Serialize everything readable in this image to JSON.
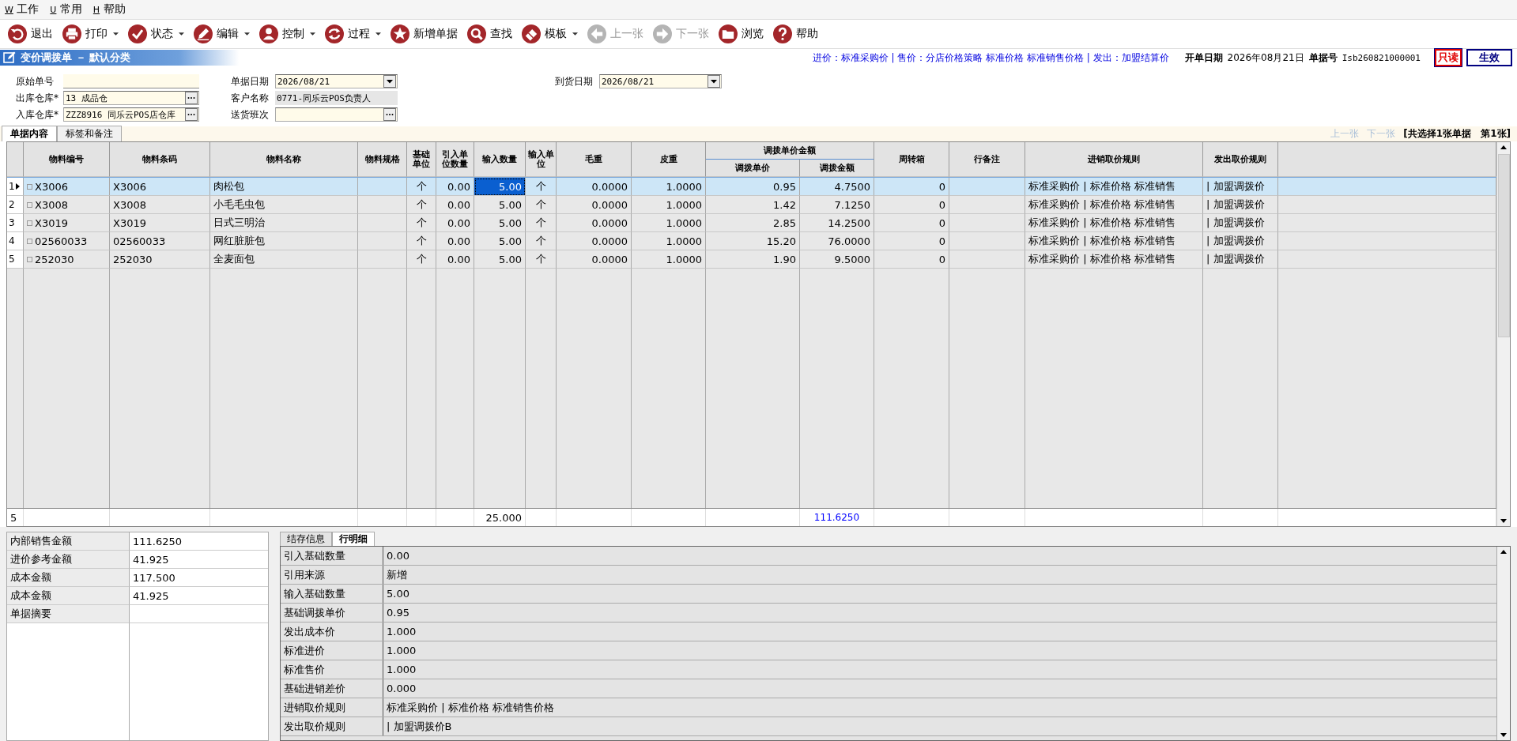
{
  "menu": [
    {
      "key": "W",
      "label": "工作"
    },
    {
      "key": "U",
      "label": "常用"
    },
    {
      "key": "H",
      "label": "帮助"
    }
  ],
  "toolbar": [
    {
      "label": "退出",
      "dropdown": false,
      "disabled": false
    },
    {
      "label": "打印",
      "dropdown": true,
      "disabled": false
    },
    {
      "label": "状态",
      "dropdown": true,
      "disabled": false
    },
    {
      "label": "编辑",
      "dropdown": true,
      "disabled": false
    },
    {
      "label": "控制",
      "dropdown": true,
      "disabled": false
    },
    {
      "label": "过程",
      "dropdown": true,
      "disabled": false
    },
    {
      "label": "新增单据",
      "dropdown": false,
      "disabled": false
    },
    {
      "label": "查找",
      "dropdown": false,
      "disabled": false
    },
    {
      "label": "模板",
      "dropdown": true,
      "disabled": false
    },
    {
      "label": "上一张",
      "dropdown": false,
      "disabled": true
    },
    {
      "label": "下一张",
      "dropdown": false,
      "disabled": true
    },
    {
      "label": "浏览",
      "dropdown": false,
      "disabled": false
    },
    {
      "label": "帮助",
      "dropdown": false,
      "disabled": false
    }
  ],
  "document": {
    "title": "变价调拨单 － 默认分类",
    "pricing_note": "进价：标准采购价 | 售价：分店价格策略 标准价格 标准销售价格 | 发出：加盟结算价",
    "date_label": "开单日期",
    "date": "2026年08月21日",
    "number_label": "单据号",
    "number": "Isb260821000001",
    "badges": [
      {
        "label": "只读",
        "kind": "readonly"
      },
      {
        "label": "生效",
        "kind": "status"
      }
    ]
  },
  "form": {
    "columns": [
      [
        {
          "label": "原始单号",
          "kind": "text"
        },
        {
          "label": "出库仓库*",
          "value": "13 成品仓",
          "kind": "lookup"
        },
        {
          "label": "入库仓库*",
          "value": "ZZZ8916 同乐云POS店仓库",
          "kind": "lookup"
        }
      ],
      [
        {
          "label": "单据日期",
          "value": "2026/08/21",
          "kind": "date"
        },
        {
          "label": "客户名称",
          "value": "0771-同乐云POS负责人",
          "kind": "readonly"
        },
        {
          "label": "送货班次",
          "kind": "lookup"
        }
      ],
      [
        {
          "label": "到货日期",
          "value": "2026/08/21",
          "kind": "date"
        }
      ]
    ]
  },
  "tabs": [
    {
      "label": "单据内容",
      "selected": true
    },
    {
      "label": "标签和备注",
      "selected": false
    }
  ],
  "pager": {
    "buttons": [
      {
        "label": "上一张",
        "disabled": true
      },
      {
        "label": "下一张",
        "disabled": true
      }
    ],
    "summary": "[共选择1张单据　第1张]"
  },
  "grid": {
    "columns": [
      {
        "label": "物料编号",
        "kind": "text",
        "editing": false
      },
      {
        "label": "物料条码",
        "kind": "text",
        "editing": false
      },
      {
        "label": "物料名称",
        "kind": "text",
        "editing": false
      },
      {
        "label": "物料规格",
        "kind": "text",
        "editing": false
      },
      {
        "label": "基础单位",
        "kind": "unit",
        "editing": false
      },
      {
        "label": "引入单位数量",
        "kind": "number",
        "editing": false
      },
      {
        "label": "输入数量",
        "kind": "number",
        "editing": true
      },
      {
        "label": "输入单位",
        "kind": "unit",
        "editing": false
      },
      {
        "label": "毛重",
        "kind": "number",
        "editing": false
      },
      {
        "label": "皮重",
        "kind": "number",
        "editing": false
      },
      {
        "label": "调拨单价",
        "kind": "number",
        "editing": false,
        "group": "调拨单价金额"
      },
      {
        "label": "调拨金额",
        "kind": "number",
        "editing": false,
        "group_continued": true
      },
      {
        "label": "周转箱",
        "kind": "number",
        "editing": false
      },
      {
        "label": "行备注",
        "kind": "text",
        "editing": false
      },
      {
        "label": "进销取价规则",
        "kind": "text",
        "editing": false
      },
      {
        "label": "发出取价规则",
        "kind": "text",
        "editing": false
      }
    ],
    "rows": [
      {
        "number": "1",
        "selected": true,
        "cells": [
          "X3006",
          "X3006",
          "肉松包",
          null,
          "个",
          "0.00",
          "5.00",
          "个",
          "0.0000",
          "1.0000",
          "0.95",
          "4.7500",
          "0",
          null,
          "标准采购价 | 标准价格 标准销售",
          "| 加盟调拨价"
        ]
      },
      {
        "number": "2",
        "selected": false,
        "cells": [
          "X3008",
          "X3008",
          "小毛毛虫包",
          null,
          "个",
          "0.00",
          "5.00",
          "个",
          "0.0000",
          "1.0000",
          "1.42",
          "7.1250",
          "0",
          null,
          "标准采购价 | 标准价格 标准销售",
          "| 加盟调拨价"
        ]
      },
      {
        "number": "3",
        "selected": false,
        "cells": [
          "X3019",
          "X3019",
          "日式三明治",
          null,
          "个",
          "0.00",
          "5.00",
          "个",
          "0.0000",
          "1.0000",
          "2.85",
          "14.2500",
          "0",
          null,
          "标准采购价 | 标准价格 标准销售",
          "| 加盟调拨价"
        ]
      },
      {
        "number": "4",
        "selected": false,
        "cells": [
          "02560033",
          "02560033",
          "网红脏脏包",
          null,
          "个",
          "0.00",
          "5.00",
          "个",
          "0.0000",
          "1.0000",
          "15.20",
          "76.0000",
          "0",
          null,
          "标准采购价 | 标准价格 标准销售",
          "| 加盟调拨价"
        ]
      },
      {
        "number": "5",
        "selected": false,
        "cells": [
          "252030",
          "252030",
          "全麦面包",
          null,
          "个",
          "0.00",
          "5.00",
          "个",
          "0.0000",
          "1.0000",
          "1.90",
          "9.5000",
          "0",
          null,
          "标准采购价 | 标准价格 标准销售",
          "| 加盟调拨价"
        ]
      }
    ],
    "footer": {
      "count": "5",
      "cells": [
        null,
        null,
        null,
        null,
        null,
        null,
        "25.000",
        null,
        null,
        null,
        null,
        "111.6250",
        null,
        null,
        null,
        null
      ]
    }
  },
  "summary": [
    {
      "label": "内部销售金额",
      "value": "111.6250"
    },
    {
      "label": "进价参考金额",
      "value": "41.925"
    },
    {
      "label": "成本金额",
      "value": "117.500"
    },
    {
      "label": "成本金额",
      "value": "41.925"
    },
    {
      "label": "单据摘要"
    }
  ],
  "detail_tabs": [
    {
      "label": "结存信息",
      "selected": false
    },
    {
      "label": "行明细",
      "selected": true
    }
  ],
  "details": [
    {
      "label": "引入基础数量",
      "value": "0.00"
    },
    {
      "label": "引用来源",
      "value": "新增"
    },
    {
      "label": "输入基础数量",
      "value": "5.00"
    },
    {
      "label": "基础调拨单价",
      "value": "0.95"
    },
    {
      "label": "发出成本价",
      "value": "1.000"
    },
    {
      "label": "标准进价",
      "value": "1.000"
    },
    {
      "label": "标准售价",
      "value": "1.000"
    },
    {
      "label": "基础进销差价",
      "value": "0.000"
    },
    {
      "label": "进销取价规则",
      "value": "标准采购价 | 标准价格 标准销售价格"
    },
    {
      "label": "发出取价规则",
      "value": "| 加盟调拨价B"
    }
  ]
}
